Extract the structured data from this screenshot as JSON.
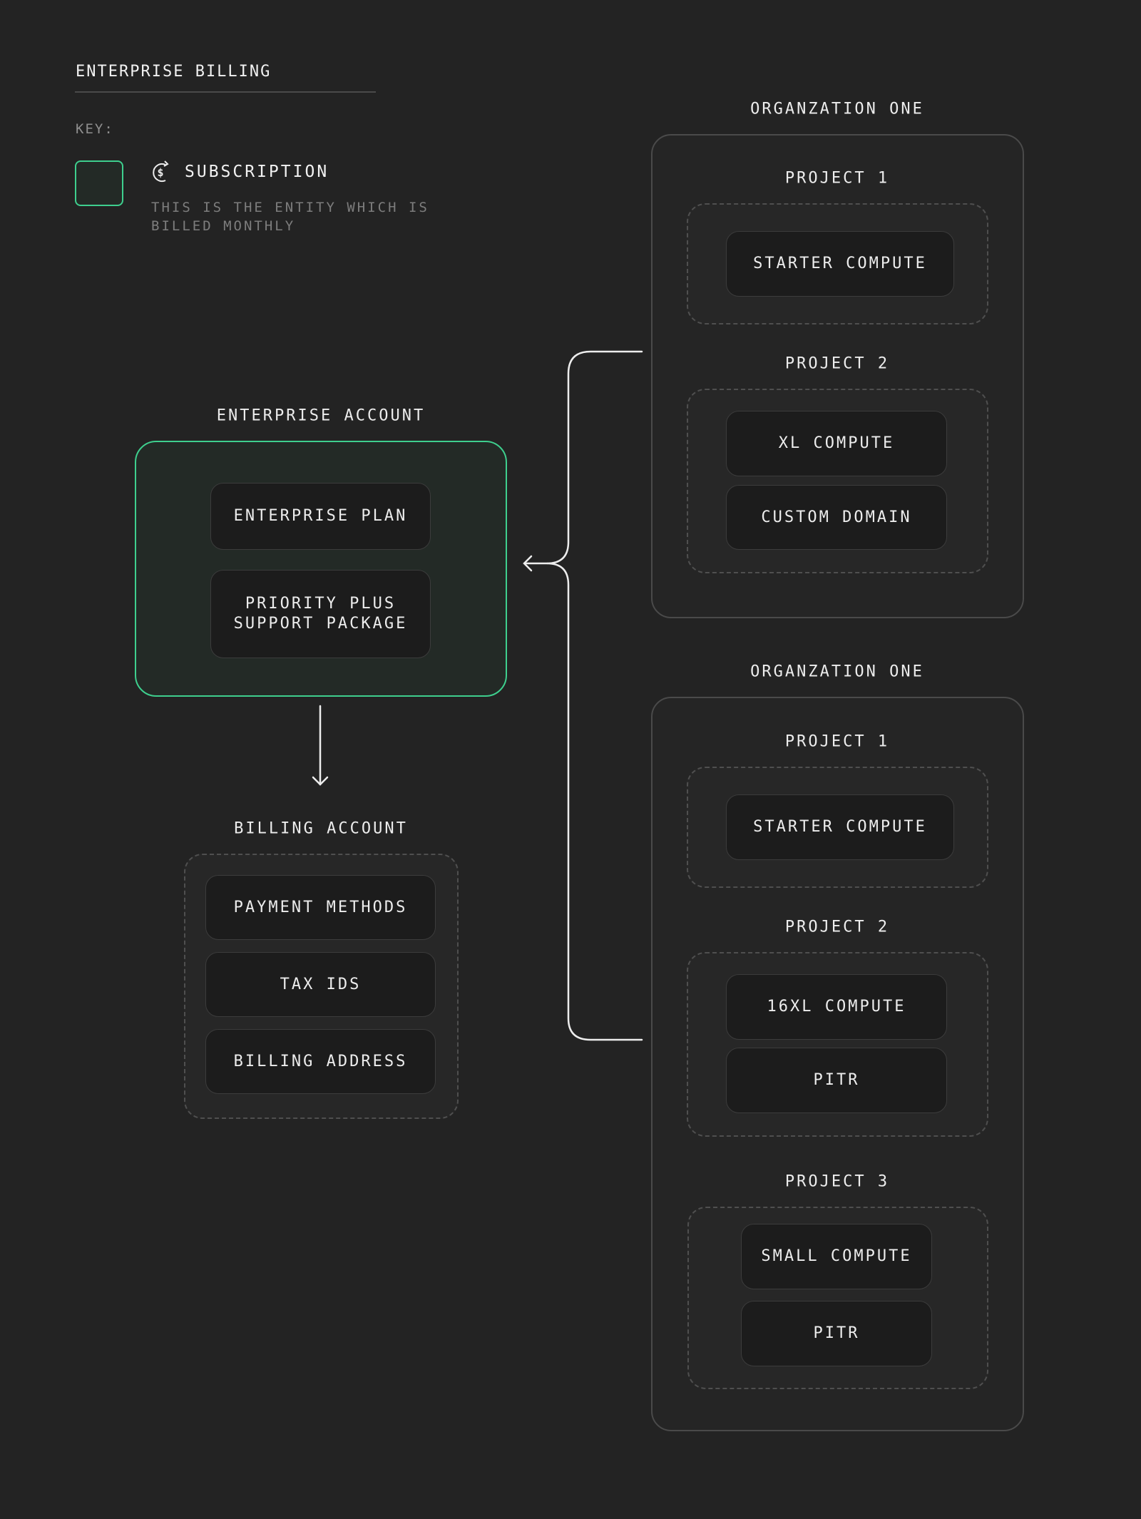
{
  "header": {
    "title": "ENTERPRISE BILLING"
  },
  "key": {
    "label": "KEY:",
    "swatch_color": "#3ecf8e",
    "icon": "dollar-refresh-icon",
    "name": "SUBSCRIPTION",
    "description_line1": "THIS IS THE ENTITY WHICH IS",
    "description_line2": "BILLED MONTHLY"
  },
  "enterprise_account": {
    "label": "ENTERPRISE ACCOUNT",
    "items": [
      {
        "line1": "ENTERPRISE PLAN",
        "line2": ""
      },
      {
        "line1": "PRIORITY PLUS",
        "line2": "SUPPORT PACKAGE"
      }
    ]
  },
  "billing_account": {
    "label": "BILLING ACCOUNT",
    "items": [
      "PAYMENT METHODS",
      "TAX IDS",
      "BILLING ADDRESS"
    ]
  },
  "organizations": [
    {
      "label": "ORGANZATION ONE",
      "projects": [
        {
          "label": "PROJECT 1",
          "items": [
            "STARTER COMPUTE"
          ]
        },
        {
          "label": "PROJECT 2",
          "items": [
            "XL COMPUTE",
            "CUSTOM DOMAIN"
          ]
        }
      ]
    },
    {
      "label": "ORGANZATION ONE",
      "projects": [
        {
          "label": "PROJECT 1",
          "items": [
            "STARTER COMPUTE"
          ]
        },
        {
          "label": "PROJECT 2",
          "items": [
            "16XL COMPUTE",
            "PITR"
          ]
        },
        {
          "label": "PROJECT 3",
          "items": [
            "SMALL COMPUTE",
            "PITR"
          ]
        }
      ]
    }
  ],
  "colors": {
    "accent": "#3ecf8e",
    "background": "#232323",
    "item_fill": "#1c1c1c"
  }
}
